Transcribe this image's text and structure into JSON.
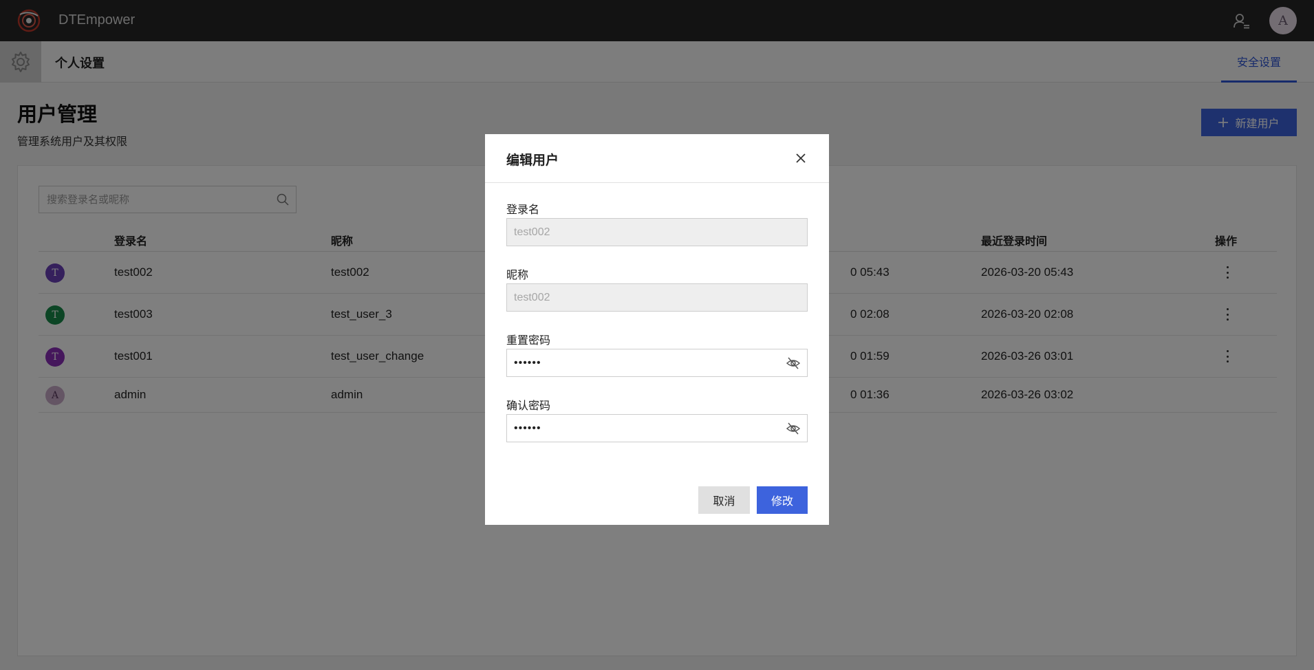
{
  "app": {
    "brand": "DTEmpower",
    "user_initial": "A"
  },
  "subheader": {
    "title": "个人设置",
    "tab_security": "安全设置"
  },
  "page": {
    "title": "用户管理",
    "subtitle": "管理系统用户及其权限",
    "new_user_label": "新建用户"
  },
  "search": {
    "placeholder": "搜索登录名或昵称"
  },
  "table": {
    "headers": {
      "login": "登录名",
      "nickname": "昵称",
      "last_login": "最近登录时间",
      "actions": "操作"
    },
    "rows": [
      {
        "initial": "T",
        "avatar_color": "#6a40b8",
        "login": "test002",
        "nickname": "test002",
        "created_partial": "0 05:43",
        "last_login": "2026-03-20 05:43"
      },
      {
        "initial": "T",
        "avatar_color": "#188a4a",
        "login": "test003",
        "nickname": "test_user_3",
        "created_partial": "0 02:08",
        "last_login": "2026-03-20 02:08"
      },
      {
        "initial": "T",
        "avatar_color": "#8a2fb8",
        "login": "test001",
        "nickname": "test_user_change",
        "created_partial": "0 01:59",
        "last_login": "2026-03-26 03:01"
      },
      {
        "initial": "A",
        "avatar_color": "#c9aac9",
        "login": "admin",
        "nickname": "admin",
        "created_partial": "0 01:36",
        "last_login": "2026-03-26 03:02"
      }
    ]
  },
  "modal": {
    "title": "编辑用户",
    "login_label": "登录名",
    "login_value": "test002",
    "nickname_label": "昵称",
    "nickname_value": "test002",
    "reset_pw_label": "重置密码",
    "reset_pw_value": "••••••",
    "confirm_pw_label": "确认密码",
    "confirm_pw_value": "••••••",
    "cancel_label": "取消",
    "submit_label": "修改"
  },
  "colors": {
    "accent": "#3d63dd",
    "topbar": "#262626"
  },
  "icons": [
    "logo-icon",
    "user-list-icon",
    "gear-icon",
    "plus-icon",
    "search-icon",
    "kebab-icon",
    "close-icon",
    "eye-off-icon"
  ]
}
